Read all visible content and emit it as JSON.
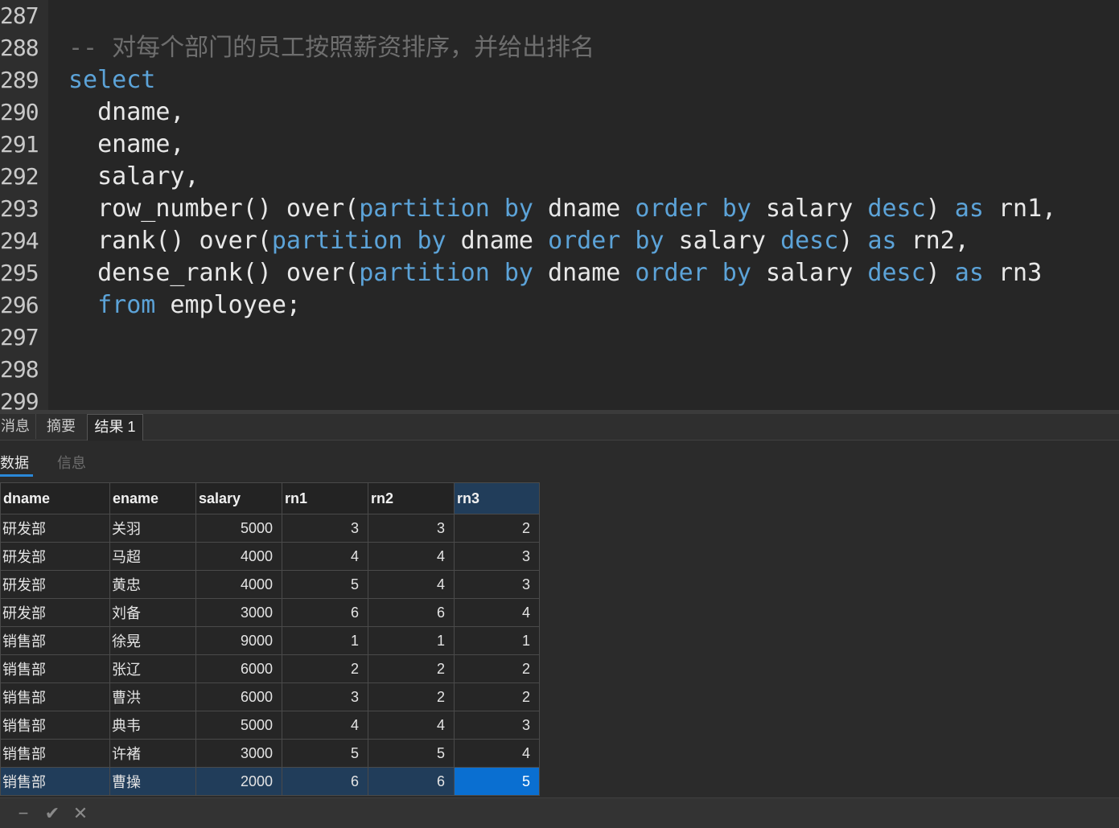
{
  "editor": {
    "lines": [
      {
        "num": "287",
        "tokens": []
      },
      {
        "num": "288",
        "tokens": [
          {
            "t": "-- 对每个部门的员工按照薪资排序，并给出排名",
            "c": "cm"
          }
        ]
      },
      {
        "num": "289",
        "tokens": [
          {
            "t": "select",
            "c": "kw"
          }
        ]
      },
      {
        "num": "290",
        "tokens": [
          {
            "t": "  dname,",
            "c": ""
          }
        ]
      },
      {
        "num": "291",
        "tokens": [
          {
            "t": "  ename,",
            "c": ""
          }
        ]
      },
      {
        "num": "292",
        "tokens": [
          {
            "t": "  salary,",
            "c": ""
          }
        ]
      },
      {
        "num": "293",
        "tokens": [
          {
            "t": "  row_number() over(",
            "c": ""
          },
          {
            "t": "partition by",
            "c": "kw"
          },
          {
            "t": " dname ",
            "c": ""
          },
          {
            "t": "order by",
            "c": "kw"
          },
          {
            "t": " salary ",
            "c": ""
          },
          {
            "t": "desc",
            "c": "kw"
          },
          {
            "t": ") ",
            "c": ""
          },
          {
            "t": "as",
            "c": "kw"
          },
          {
            "t": " rn1,",
            "c": ""
          }
        ]
      },
      {
        "num": "294",
        "tokens": [
          {
            "t": "  rank() over(",
            "c": ""
          },
          {
            "t": "partition by",
            "c": "kw"
          },
          {
            "t": " dname ",
            "c": ""
          },
          {
            "t": "order by",
            "c": "kw"
          },
          {
            "t": " salary ",
            "c": ""
          },
          {
            "t": "desc",
            "c": "kw"
          },
          {
            "t": ") ",
            "c": ""
          },
          {
            "t": "as",
            "c": "kw"
          },
          {
            "t": " rn2,",
            "c": ""
          }
        ]
      },
      {
        "num": "295",
        "tokens": [
          {
            "t": "  dense_rank() over(",
            "c": ""
          },
          {
            "t": "partition by",
            "c": "kw"
          },
          {
            "t": " dname ",
            "c": ""
          },
          {
            "t": "order by",
            "c": "kw"
          },
          {
            "t": " salary ",
            "c": ""
          },
          {
            "t": "desc",
            "c": "kw"
          },
          {
            "t": ") ",
            "c": ""
          },
          {
            "t": "as",
            "c": "kw"
          },
          {
            "t": " rn3",
            "c": ""
          }
        ]
      },
      {
        "num": "296",
        "tokens": [
          {
            "t": "  ",
            "c": ""
          },
          {
            "t": "from",
            "c": "kw"
          },
          {
            "t": " employee;",
            "c": ""
          }
        ]
      },
      {
        "num": "297",
        "tokens": []
      },
      {
        "num": "298",
        "tokens": []
      },
      {
        "num": "299",
        "tokens": []
      }
    ]
  },
  "tabs": [
    {
      "label": "消息",
      "active": false
    },
    {
      "label": "摘要",
      "active": false
    },
    {
      "label": "结果 1",
      "active": true
    }
  ],
  "subtabs": [
    {
      "label": "数据",
      "active": true
    },
    {
      "label": "信息",
      "active": false
    }
  ],
  "grid": {
    "columns": [
      "dname",
      "ename",
      "salary",
      "rn1",
      "rn2",
      "rn3"
    ],
    "rows": [
      [
        "研发部",
        "关羽",
        "5000",
        "3",
        "3",
        "2"
      ],
      [
        "研发部",
        "马超",
        "4000",
        "4",
        "4",
        "3"
      ],
      [
        "研发部",
        "黄忠",
        "4000",
        "5",
        "4",
        "3"
      ],
      [
        "研发部",
        "刘备",
        "3000",
        "6",
        "6",
        "4"
      ],
      [
        "销售部",
        "徐晃",
        "9000",
        "1",
        "1",
        "1"
      ],
      [
        "销售部",
        "张辽",
        "6000",
        "2",
        "2",
        "2"
      ],
      [
        "销售部",
        "曹洪",
        "6000",
        "3",
        "2",
        "2"
      ],
      [
        "销售部",
        "典韦",
        "5000",
        "4",
        "4",
        "3"
      ],
      [
        "销售部",
        "许褚",
        "3000",
        "5",
        "5",
        "4"
      ],
      [
        "销售部",
        "曹操",
        "2000",
        "6",
        "6",
        "5"
      ]
    ],
    "selected_row": 9,
    "selected_col": 5
  },
  "statusbar": {
    "icons": [
      "minus-icon",
      "check-icon",
      "close-icon"
    ],
    "glyphs": [
      "−",
      "✔",
      "✕"
    ]
  },
  "colors": {
    "keyword": "#5ca3d8",
    "comment": "#6e6e6e",
    "selection": "#0a6fd1",
    "selected_row": "#213d5a"
  }
}
